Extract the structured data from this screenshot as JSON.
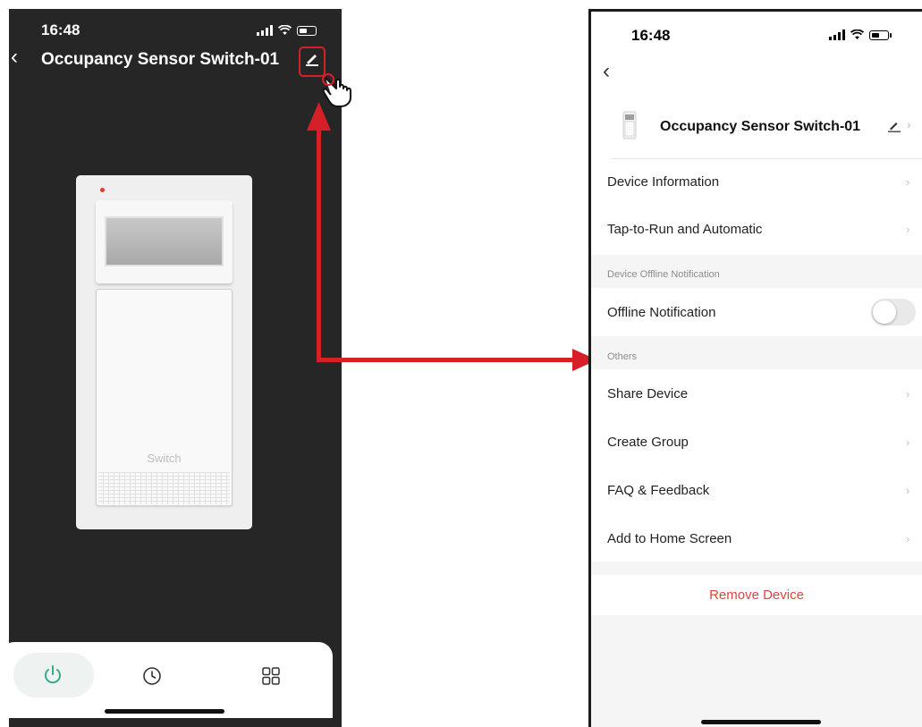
{
  "left_screen": {
    "status_time": "16:48",
    "title": "Occupancy Sensor Switch-01",
    "device_image_label": "Switch",
    "bottom_tabs": [
      {
        "icon": "power-icon",
        "active": true
      },
      {
        "icon": "clock-icon",
        "active": false
      },
      {
        "icon": "grid-icon",
        "active": false
      }
    ]
  },
  "right_screen": {
    "status_time": "16:48",
    "device_name": "Occupancy Sensor Switch-01",
    "menu_top": [
      {
        "label": "Device Information"
      },
      {
        "label": "Tap-to-Run and Automatic"
      }
    ],
    "section_offline": "Device Offline Notification",
    "offline_notification": {
      "label": "Offline Notification",
      "enabled": false
    },
    "section_others": "Others",
    "menu_others": [
      {
        "label": "Share Device"
      },
      {
        "label": "Create Group"
      },
      {
        "label": "FAQ & Feedback"
      },
      {
        "label": "Add to Home Screen"
      }
    ],
    "remove_device": "Remove Device"
  },
  "colors": {
    "accent_red": "#d61f26",
    "remove_red": "#e0443e",
    "power_green": "#3aa88a",
    "dark_bg": "#262626"
  }
}
